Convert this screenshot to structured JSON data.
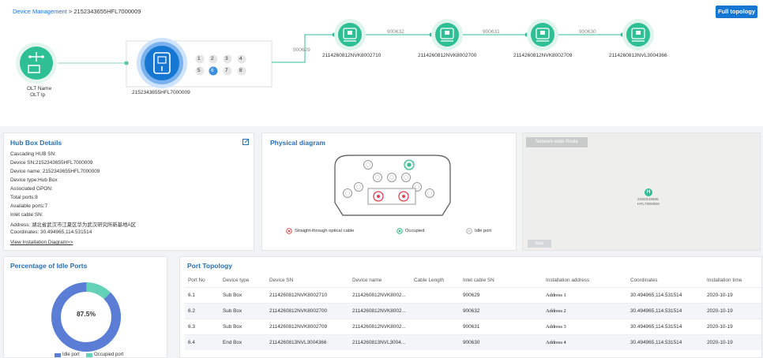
{
  "breadcrumb": {
    "root": "Device Management",
    "sep": " > ",
    "current": "2152343655HFL7000009"
  },
  "toolbar": {
    "full_topology": "Full topology"
  },
  "topology": {
    "olt": {
      "name": "OLT Name",
      "ip": "OLT Ip"
    },
    "hub": {
      "sn": "2152343655HFL7000009",
      "ports": [
        "1",
        "2",
        "3",
        "4",
        "5",
        "6",
        "7",
        "8"
      ],
      "active_port": "6"
    },
    "links": [
      "900629",
      "900632",
      "900631",
      "900630"
    ],
    "nodes": [
      "2114260812NVK8002710",
      "2114260812NVK8002700",
      "2114260812NVK8002709",
      "2114260813NVL3004366"
    ]
  },
  "hub_details": {
    "title": "Hub Box Details",
    "rows": [
      "Cascading HUB SN:",
      "Device SN:2152343655HFL7000009",
      "Device name: 2152343655HFL7000009",
      "Device type:Hub Box",
      "Associated GPON:",
      "Total ports:8",
      "Available ports:7",
      "Inlet cable SN:",
      "Address: 湖北省武汉市江夏区华为武汉研究所新基地A区",
      "Coordinates: 30.494965,114.531514"
    ],
    "link": "View Installation Diagram>>"
  },
  "physical": {
    "title": "Physical diagram",
    "legend": [
      "Straight-through optical cable",
      "Occupied",
      "Idle port"
    ],
    "colors": {
      "straight": "#e0464f",
      "occupied": "#3cb98f",
      "idle": "#a9a9a9"
    }
  },
  "map": {
    "tag": "Network-wide Route",
    "marker": "H",
    "label1": "2152343655",
    "label2": "HFL7000009",
    "btn": "Map"
  },
  "idle": {
    "title": "Percentage of Idle Ports",
    "value": 87.5,
    "center": "87.5%",
    "legend": [
      "Idle port",
      "Occupied port"
    ],
    "colors": [
      "#5b7dd6",
      "#63d2b7"
    ]
  },
  "port_topology": {
    "title": "Port Topology",
    "columns": [
      "Port No",
      "Device type",
      "Device SN",
      "Device name",
      "Cable Length",
      "Inlet cable SN",
      "Installation address",
      "Coordinates",
      "Installation time"
    ],
    "rows": [
      [
        "6.1",
        "Sub Box",
        "2114260812NVK8002710",
        "2114260812NVK8002...",
        "",
        "900629",
        "Address 1",
        "30.494965,114.531514",
        "2020-10-19"
      ],
      [
        "6.2",
        "Sub Box",
        "2114260812NVK8002700",
        "2114260812NVK8002...",
        "",
        "900632",
        "Address 2",
        "30.494965,114.531514",
        "2020-10-19"
      ],
      [
        "6.3",
        "Sub Box",
        "2114260812NVK8002709",
        "2114260812NVK8002...",
        "",
        "900631",
        "Address 3",
        "30.494965,114.531514",
        "2020-10-19"
      ],
      [
        "6.4",
        "End Box",
        "2114260813NVL3004366",
        "2114260813NVL3004...",
        "",
        "900630",
        "Address 4",
        "30.494965,114.531514",
        "2020-10-19"
      ]
    ]
  },
  "icons": {
    "olt": "network-switch-icon",
    "hub": "hub-box-icon",
    "subbox": "sub-box-icon",
    "edit": "edit-icon"
  },
  "colors": {
    "accent": "#1677d2",
    "node": "#2fbf95",
    "title": "#2a6fb7"
  }
}
